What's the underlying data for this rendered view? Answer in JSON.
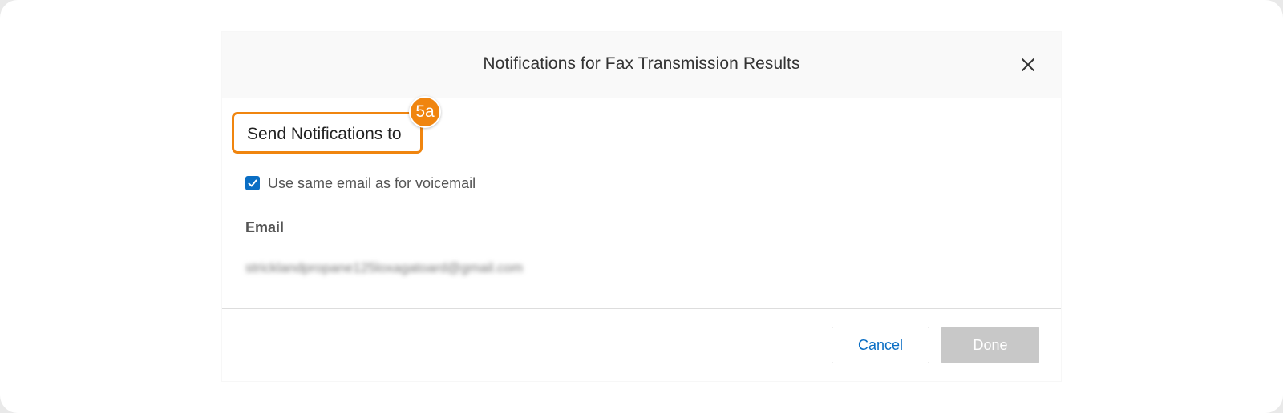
{
  "modal": {
    "title": "Notifications for Fax Transmission Results",
    "section_heading": "Send Notifications to",
    "step_badge": "5a",
    "checkbox": {
      "label": "Use same email as for voicemail",
      "checked": true
    },
    "email_label": "Email",
    "email_value": "stricklandpropane125loxagatoard@gmail.com",
    "cancel_label": "Cancel",
    "done_label": "Done"
  },
  "colors": {
    "accent_blue": "#0a6ec4",
    "highlight_orange": "#f0850f",
    "done_disabled": "#c8c8c8"
  },
  "icons": {
    "close": "close-icon",
    "check": "checkmark-icon"
  }
}
